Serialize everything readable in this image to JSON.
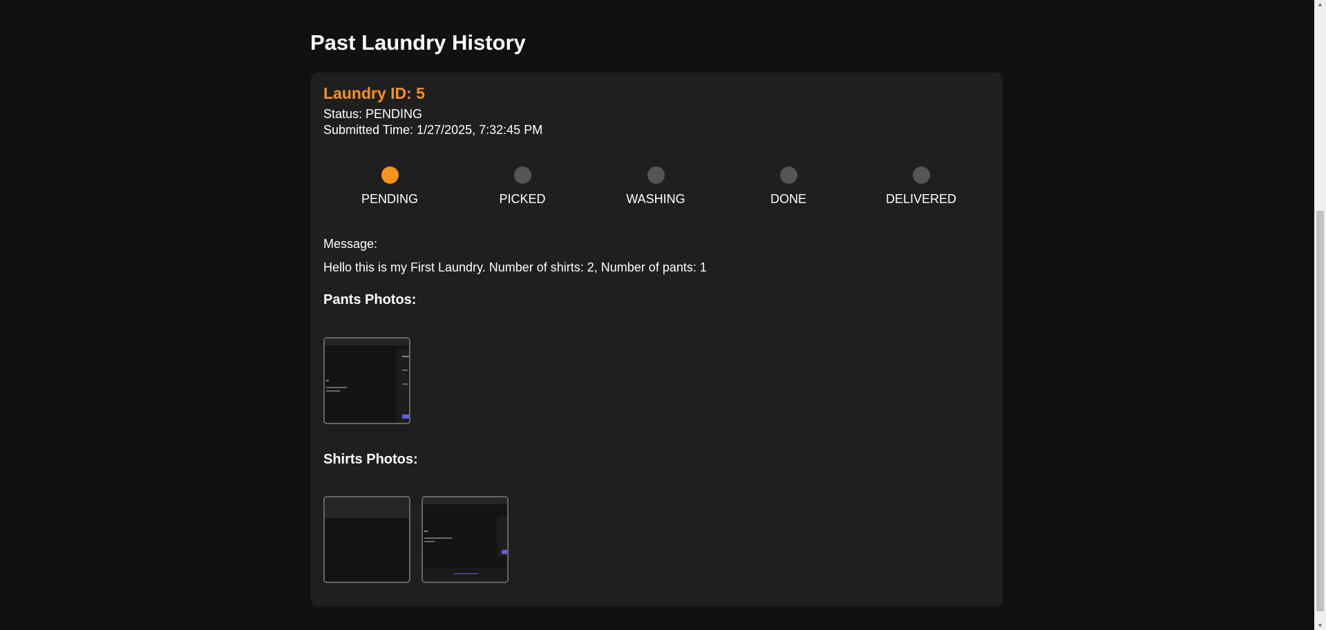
{
  "page": {
    "title": "Past Laundry History"
  },
  "laundry": {
    "id_label": "Laundry ID: 5",
    "status_label": "Status: PENDING",
    "submitted_label": "Submitted Time: 1/27/2025, 7:32:45 PM",
    "steps": [
      {
        "label": "PENDING",
        "active": true
      },
      {
        "label": "PICKED",
        "active": false
      },
      {
        "label": "WASHING",
        "active": false
      },
      {
        "label": "DONE",
        "active": false
      },
      {
        "label": "DELIVERED",
        "active": false
      }
    ],
    "message_heading": "Message:",
    "message_text": "Hello this is my First Laundry. Number of shirts: 2, Number of pants: 1",
    "pants_heading": "Pants Photos:",
    "shirts_heading": "Shirts Photos:"
  },
  "colors": {
    "background": "#111111",
    "card": "#1f1f1f",
    "accent": "#f7931e",
    "inactive_step": "#555555"
  },
  "icons": {
    "scroll_up": "triangle-up",
    "scroll_down": "triangle-down"
  }
}
